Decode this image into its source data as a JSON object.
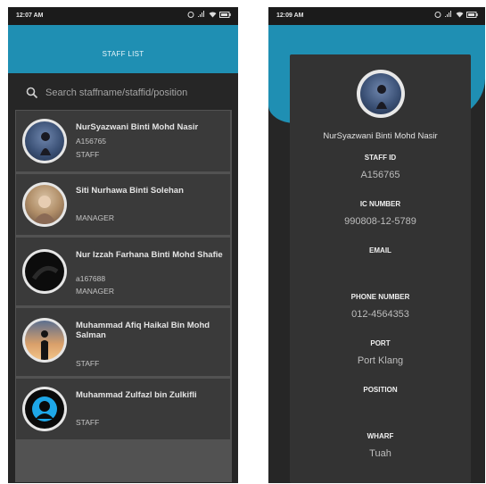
{
  "left": {
    "status": {
      "time": "12:07 AM"
    },
    "appbar": {
      "title": "STAFF LIST"
    },
    "search": {
      "placeholder": "Search staffname/staffid/position"
    },
    "staff": [
      {
        "name": "NurSyazwani Binti Mohd Nasir",
        "staff_id": "A156765",
        "position": "STAFF"
      },
      {
        "name": "Siti Nurhawa Binti Solehan",
        "staff_id": "",
        "position": "MANAGER"
      },
      {
        "name": "Nur Izzah Farhana Binti Mohd Shafie",
        "staff_id": "a167688",
        "position": "MANAGER"
      },
      {
        "name": "Muhammad Afiq Haikal Bin Mohd Salman",
        "staff_id": "",
        "position": "STAFF"
      },
      {
        "name": "Muhammad Zulfazl bin Zulkifli",
        "staff_id": "",
        "position": "STAFF"
      }
    ]
  },
  "right": {
    "status": {
      "time": "12:09 AM"
    },
    "profile": {
      "name": "NurSyazwani Binti Mohd Nasir",
      "staff_id_label": "STAFF ID",
      "staff_id": "A156765",
      "ic_label": "IC NUMBER",
      "ic": "990808-12-5789",
      "email_label": "EMAIL",
      "email": "",
      "phone_label": "PHONE NUMBER",
      "phone": "012-4564353",
      "port_label": "PORT",
      "port": "Port Klang",
      "position_label": "POSITION",
      "position": "",
      "wharf_label": "WHARF",
      "wharf": "Tuah"
    }
  },
  "colors": {
    "accent": "#1f8fb3",
    "card": "#3a3a3a",
    "background": "#262626"
  }
}
